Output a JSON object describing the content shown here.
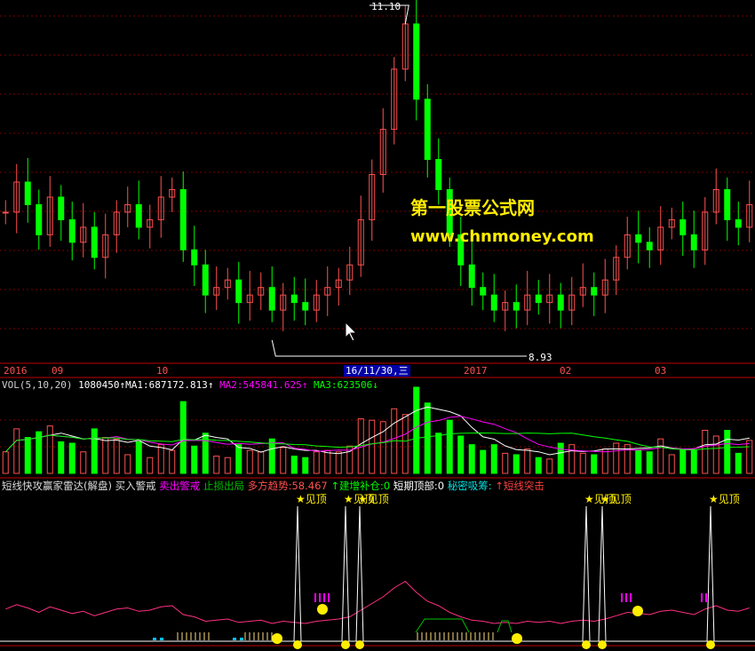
{
  "watermark": {
    "title": "第一股票公式网",
    "url": "www.chnmoney.com"
  },
  "price_pane": {
    "high_label": "11.10",
    "low_label": "8.93",
    "axis_labels": [
      "2016",
      "09",
      "10",
      "2017",
      "02",
      "03"
    ],
    "cursor_date": "16/11/30,三"
  },
  "volume_pane": {
    "prefix": "VOL(5,10,20)",
    "vol_value": "1080450",
    "ma1": "MA1:687172.813",
    "ma2": "MA2:545841.625",
    "ma3": "MA3:623506"
  },
  "indicator_pane": {
    "title": "短线快攻赢家雷达(解盘)",
    "items": [
      "买入警戒",
      "卖出警戒",
      "止损出局",
      "多方趋势:58.467",
      "建增补仓:0",
      "短期顶部:0",
      "秘密吸筹:",
      "短线突击"
    ],
    "peak_label": "见顶",
    "signal_count": 6
  },
  "colors": {
    "up": "#ff5050",
    "down": "#00ff00",
    "ma1": "#ffffff",
    "ma2": "#ff00ff",
    "ma3": "#00ff00",
    "grid": "#7a0000",
    "separator": "#c00000",
    "warn": "#ffee00",
    "sell": "#ff00ff",
    "buy_icon": "#ffee00"
  },
  "chart_data": {
    "type": "line",
    "title": "",
    "price": [
      9.85,
      10.05,
      9.9,
      9.7,
      9.95,
      9.8,
      9.65,
      9.75,
      9.55,
      9.7,
      9.85,
      9.9,
      9.75,
      9.8,
      9.95,
      10.0,
      9.6,
      9.5,
      9.3,
      9.35,
      9.4,
      9.25,
      9.3,
      9.35,
      9.2,
      9.3,
      9.25,
      9.2,
      9.3,
      9.35,
      9.4,
      9.5,
      9.8,
      10.1,
      10.4,
      10.8,
      11.1,
      10.6,
      10.2,
      10.0,
      9.7,
      9.5,
      9.35,
      9.3,
      9.2,
      9.25,
      9.2,
      9.3,
      9.25,
      9.3,
      9.2,
      9.3,
      9.35,
      9.3,
      9.4,
      9.55,
      9.7,
      9.65,
      9.6,
      9.75,
      9.8,
      9.7,
      9.6,
      9.85,
      10.0,
      9.8,
      9.75,
      9.9
    ],
    "price_labels": {
      "high": 11.1,
      "low": 8.93
    },
    "xlabels": [
      "2016",
      "09",
      "10",
      "2017",
      "02",
      "03"
    ],
    "volume": {
      "name": "VOL",
      "value": 1080450,
      "ma1": 687172.813,
      "ma2": 545841.625,
      "ma3": 623506
    }
  }
}
